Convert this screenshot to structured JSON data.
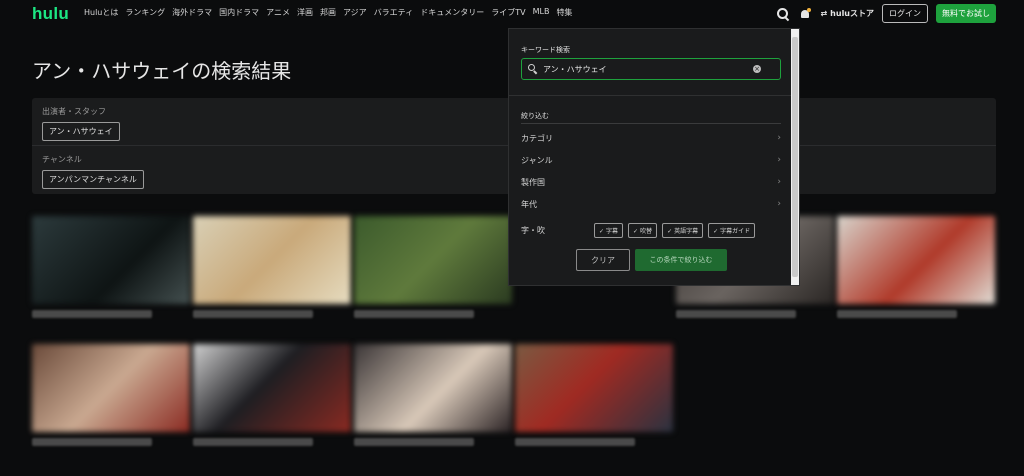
{
  "header": {
    "logo": "hulu",
    "nav": [
      "Huluとは",
      "ランキング",
      "海外ドラマ",
      "国内ドラマ",
      "アニメ",
      "洋画",
      "邦画",
      "アジア",
      "バラエティ",
      "ドキュメンタリー",
      "ライブTV",
      "MLB",
      "特集"
    ],
    "store_label": "huluストア",
    "login_label": "ログイン",
    "trial_label": "無料でお試し",
    "colors": {
      "brand": "#1ce783",
      "trial_button": "#1ea23d",
      "notification_dot": "#f2b23c"
    }
  },
  "main": {
    "title": "アン・ハサウェイの検索結果",
    "filters": {
      "cast_label": "出演者・スタッフ",
      "cast_value": "アン・ハサウェイ",
      "channel_label": "チャンネル",
      "channel_value": "アンパンマンチャンネル"
    }
  },
  "search_panel": {
    "keyword_label": "キーワード検索",
    "search_value": "アン・ハサウェイ",
    "narrow_label": "絞り込む",
    "categories": [
      "カテゴリ",
      "ジャンル",
      "製作国",
      "年代"
    ],
    "sub_label": "字・吹",
    "sub_options": [
      "字幕",
      "吹替",
      "英語字幕",
      "字幕ガイド"
    ],
    "clear_label": "クリア",
    "apply_label": "この条件で絞り込む",
    "colors": {
      "focus_border": "#1ea23d",
      "apply_button": "#1f6a30"
    }
  },
  "tiles": {
    "row1_colors": [
      "#2c3a3c",
      "#c9b98e",
      "#3b5a2c",
      "#5a2e2a",
      "#3a3532",
      "#8a7a6c"
    ],
    "row2_colors": [
      "#6a4a3a",
      "#1e1e22",
      "#3a3536",
      "#7a5a42"
    ]
  }
}
